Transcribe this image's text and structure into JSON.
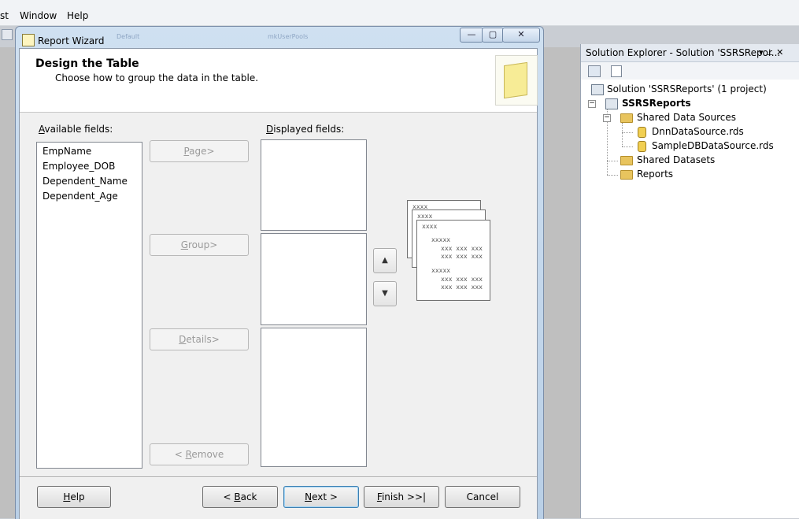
{
  "menubar": {
    "items": [
      "st",
      "Window",
      "Help"
    ]
  },
  "wizard": {
    "title": "Report Wizard",
    "ghost_tabs": [
      "Default",
      "mkUserPools"
    ],
    "controls": {
      "minimize": "—",
      "maximize": "▢",
      "close": "✕"
    },
    "header": {
      "title": "Design the Table",
      "subtitle": "Choose how to group the data in the table."
    },
    "available": {
      "label_access": "A",
      "label_rest": "vailable fields:",
      "fields": [
        "EmpName",
        "Employee_DOB",
        "Dependent_Name",
        "Dependent_Age"
      ]
    },
    "displayed": {
      "label_access": "D",
      "label_rest": "isplayed fields:"
    },
    "buttons": {
      "page": {
        "access": "P",
        "rest": "age>"
      },
      "group": {
        "access": "G",
        "rest": "roup>"
      },
      "details": {
        "access": "D",
        "rest": "etails>"
      },
      "remove": {
        "pre": "< ",
        "access": "R",
        "rest": "emove"
      },
      "up": "▲",
      "down": "▼"
    },
    "preview": {
      "p1": "xxxx",
      "p2": "xxxx",
      "p3": "xxxx",
      "g1": "xxxxx",
      "r1": "xxx xxx xxx",
      "r2": "xxx xxx xxx",
      "g2": "xxxxx",
      "r3": "xxx xxx xxx",
      "r4": "xxx xxx xxx"
    },
    "footer": {
      "help": {
        "access": "H",
        "rest": "elp"
      },
      "back": {
        "pre": "< ",
        "access": "B",
        "rest": "ack"
      },
      "next": {
        "access": "N",
        "rest": "ext >"
      },
      "finish": {
        "access": "F",
        "rest": "inish >>|"
      },
      "cancel": "Cancel"
    }
  },
  "solution_explorer": {
    "title": "Solution Explorer - Solution 'SSRSRepor...",
    "pin": "▾ ⊥ ✕",
    "nodes": {
      "solution": "Solution 'SSRSReports' (1 project)",
      "project": "SSRSReports",
      "shared_sources": "Shared Data Sources",
      "dnn": "DnnDataSource.rds",
      "sample": "SampleDBDataSource.rds",
      "shared_datasets": "Shared Datasets",
      "reports": "Reports"
    }
  }
}
